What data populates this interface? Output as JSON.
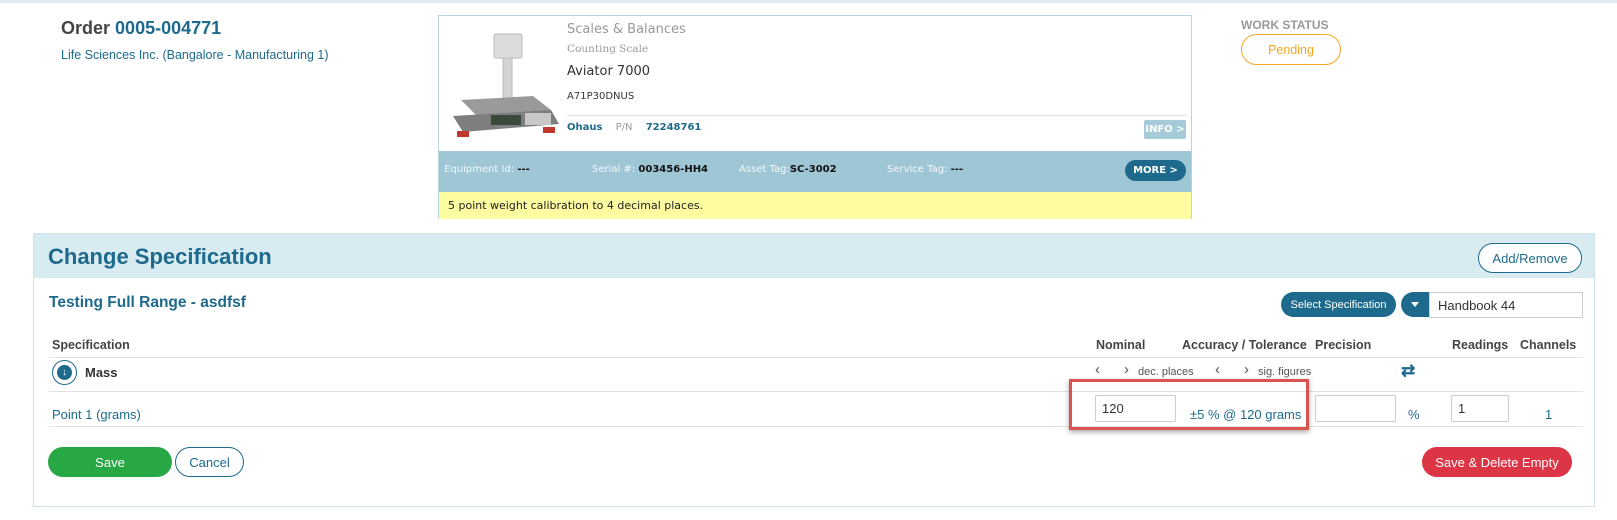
{
  "order": {
    "label": "Order",
    "number": "0005-004771",
    "customer": "Life Sciences Inc. (Bangalore - Manufacturing 1)"
  },
  "equipment": {
    "category": "Scales & Balances",
    "type": "Counting Scale",
    "model": "Aviator 7000",
    "sku": "A71P30DNUS",
    "brand": "Ohaus",
    "pn_label": "P/N",
    "pn_value": "72248761",
    "info_button": "INFO >",
    "equipment_id_label": "Equipment Id:",
    "equipment_id_value": "---",
    "serial_label": "Serial #:",
    "serial_value": "003456-HH4",
    "asset_tag_label": "Asset Tag:",
    "asset_tag_value": "SC-3002",
    "service_tag_label": "Service Tag:",
    "service_tag_value": "---",
    "more_button": "MORE >",
    "note": "5 point weight calibration to 4 decimal places."
  },
  "work_status": {
    "label": "WORK STATUS",
    "value": "Pending",
    "color": "#f5a623"
  },
  "panel": {
    "title": "Change Specification",
    "add_remove": "Add/Remove",
    "spec_name": "Testing Full Range - asdfsf",
    "select_spec_button": "Select Specification",
    "handbook_value": "Handbook 44"
  },
  "table": {
    "headers": {
      "specification": "Specification",
      "nominal": "Nominal",
      "accuracy": "Accuracy / Tolerance",
      "precision": "Precision",
      "readings": "Readings",
      "channels": "Channels"
    },
    "group": {
      "name": "Mass",
      "dec_places": "dec. places",
      "sig_figures": "sig. figures"
    },
    "rows": [
      {
        "label": "Point 1 (grams)",
        "nominal": "120",
        "tolerance": "±5 % @ 120 grams",
        "precision": "",
        "unit": "%",
        "readings": "1",
        "channels": "1"
      }
    ]
  },
  "actions": {
    "save": "Save",
    "cancel": "Cancel",
    "save_delete_empty": "Save & Delete Empty"
  },
  "colors": {
    "primary": "#1d6a8c",
    "save": "#28a745",
    "danger": "#dc3545",
    "highlight_border": "#d9534f",
    "note_bg": "#fdfca0"
  }
}
